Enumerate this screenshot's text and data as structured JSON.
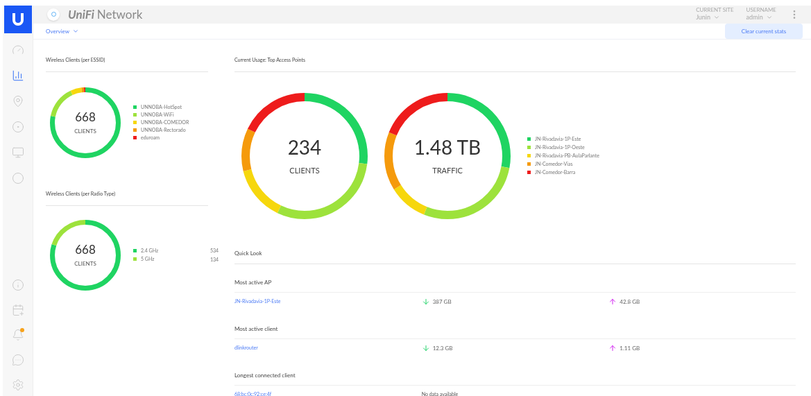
{
  "header": {
    "brand": "UniFi",
    "product": "Network",
    "site_label": "CURRENT SITE",
    "site": "Junin",
    "user_label": "USERNAME",
    "user": "admin"
  },
  "sidebar": {
    "items": [
      {
        "selected": false
      },
      {
        "selected": true
      },
      {
        "selected": false
      },
      {
        "selected": false
      },
      {
        "selected": false
      },
      {
        "selected": false
      }
    ],
    "bottom_items": [
      {
        "alert": false
      },
      {
        "alert": false
      },
      {
        "alert": true
      },
      {
        "alert": false
      },
      {
        "alert": false
      }
    ]
  },
  "toolbar": {
    "view": "Overview",
    "button": "Clear current stats"
  },
  "essid_panel": {
    "title": "Wireless Clients (per ESSID)",
    "total": "668",
    "unit": "CLIENTS",
    "legend": [
      {
        "label": "UNNOBA-HotSpot",
        "color": "#1fd462"
      },
      {
        "label": "UNNOBA-WiFi",
        "color": "#9de23c"
      },
      {
        "label": "UNNOBA-COMEDOR",
        "color": "#f6d70d"
      },
      {
        "label": "UNNOBA-Rectorado",
        "color": "#f59a0c"
      },
      {
        "label": "eduroam",
        "color": "#ee1c1c"
      }
    ]
  },
  "radio_panel": {
    "title": "Wireless Clients (per Radio Type)",
    "total": "668",
    "unit": "CLIENTS",
    "legend": [
      {
        "label": "2.4 GHz",
        "value": "534",
        "color": "#1fd462"
      },
      {
        "label": "5 GHz",
        "value": "134",
        "color": "#9de23c"
      }
    ]
  },
  "usage_panel": {
    "title": "Current Usage: Top Access Points",
    "donuts": [
      {
        "value": "234",
        "unit": "CLIENTS"
      },
      {
        "value": "1.48 TB",
        "unit": "TRAFFIC"
      }
    ],
    "legend": [
      {
        "label": "JN-Rivadavia-1P-Este",
        "color": "#1fd462"
      },
      {
        "label": "JN-Rivadavia-1P-Oeste",
        "color": "#9de23c"
      },
      {
        "label": "JN-Rivadavia-PB-AulaParlante",
        "color": "#f6d70d"
      },
      {
        "label": "JN-Comedor-Vias",
        "color": "#f59a0c"
      },
      {
        "label": "JN-Comedor-Barra",
        "color": "#ee1c1c"
      }
    ]
  },
  "quick_look": {
    "title": "Quick Look",
    "sections": [
      {
        "title": "Most active AP",
        "name": "JN-Rivadavia-1P-Este",
        "download": "387 GB",
        "upload": "42.8 GB"
      },
      {
        "title": "Most active client",
        "name": "dlinkrouter",
        "download": "12.3 GB",
        "upload": "1.11 GB"
      },
      {
        "title": "Longest connected client",
        "name": "68:bc:0c:92:ce:4f",
        "note": "No data available"
      }
    ]
  }
}
